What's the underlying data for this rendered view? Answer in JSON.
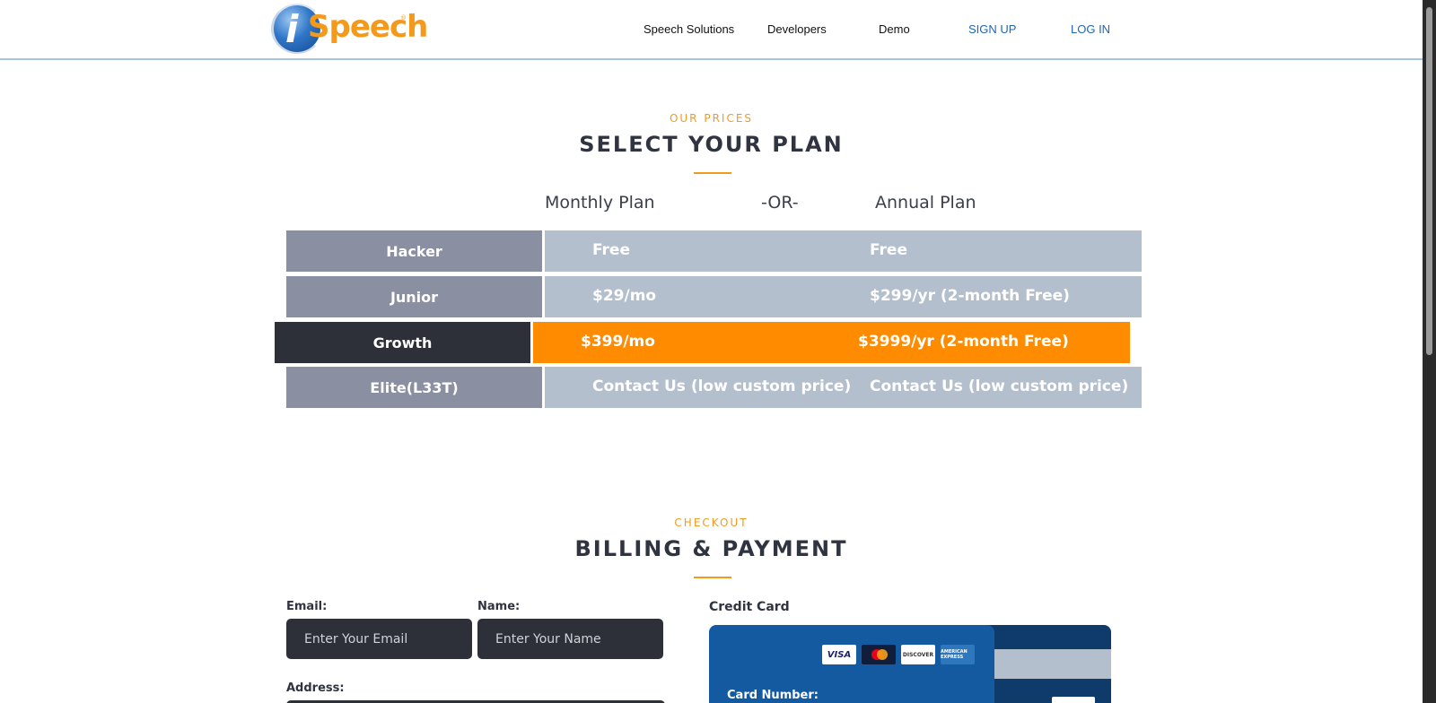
{
  "header": {
    "logo_text": "Speech",
    "logo_i": "i",
    "logo_reg": "®",
    "nav": {
      "speech_solutions": "Speech Solutions",
      "developers": "Developers",
      "demo": "Demo",
      "sign_up": "SIGN UP",
      "log_in": "LOG IN"
    }
  },
  "pricing": {
    "eyebrow": "OUR PRICES",
    "title": "SELECT YOUR PLAN",
    "monthly_label": "Monthly Plan",
    "or_label": "-OR-",
    "annual_label": "Annual Plan",
    "plans": [
      {
        "name": "Hacker",
        "monthly": "Free",
        "annual": "Free"
      },
      {
        "name": "Junior",
        "monthly": "$29/mo",
        "annual": "$299/yr (2-month Free)"
      },
      {
        "name": "Growth",
        "monthly": "$399/mo",
        "annual": "$3999/yr (2-month Free)"
      },
      {
        "name": "Elite(L33T)",
        "monthly": "Contact Us (low custom price)",
        "annual": "Contact Us (low custom price)"
      }
    ],
    "selected_plan": "Growth"
  },
  "checkout": {
    "eyebrow": "CHECKOUT",
    "title": "BILLING & PAYMENT",
    "email_label": "Email:",
    "email_placeholder": "Enter Your Email",
    "name_label": "Name:",
    "name_placeholder": "Enter Your Name",
    "address_label": "Address:",
    "credit_card_label": "Credit Card",
    "card_number_label": "Card Number:",
    "card_brands": {
      "visa": "VISA",
      "mastercard": "mastercard",
      "discover": "DISCOVER",
      "amex": "AMERICAN EXPRESS"
    }
  },
  "colors": {
    "accent": "#f39a1d",
    "selected_row": "#ff8c00",
    "dark": "#2d3038",
    "plan_name_bg": "#8a8fa2",
    "plan_price_bg": "#b4bfcd",
    "card_blue": "#135aa0"
  }
}
